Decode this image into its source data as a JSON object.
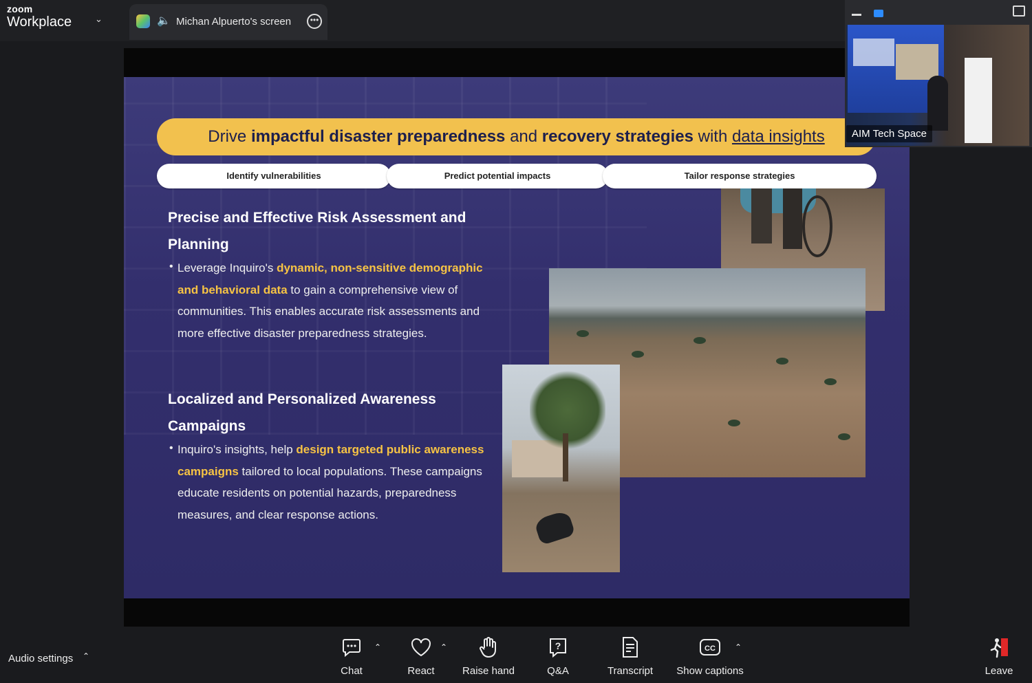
{
  "app": {
    "brand_top": "zoom",
    "brand_name": "Workplace"
  },
  "share_tab": {
    "label": "Michan Alpuerto's screen"
  },
  "thumbnail": {
    "participant_name": "AIM Tech Space"
  },
  "slide": {
    "banner": {
      "part1": "Drive ",
      "bold1": "impactful disaster preparedness",
      "part2": " and ",
      "bold2": "recovery strategies",
      "part3": " with ",
      "underlined": "data insights"
    },
    "pills": [
      "Identify vulnerabilities",
      "Predict potential impacts",
      "Tailor response strategies"
    ],
    "section1": {
      "heading": "Precise and Effective Risk Assessment and Planning",
      "text_before": "Leverage Inquiro's ",
      "highlight": "dynamic, non-sensitive demographic and behavioral data",
      "text_after": " to gain a comprehensive view of communities. This enables accurate risk assessments and more effective disaster preparedness strategies."
    },
    "section2": {
      "heading": "Localized and Personalized Awareness Campaigns",
      "text_before": "Inquiro's insights,  help ",
      "highlight": "design targeted public awareness campaigns",
      "text_after": " tailored to local populations. These campaigns educate residents on potential hazards, preparedness measures, and clear response actions."
    }
  },
  "toolbar": {
    "audio_settings": "Audio settings",
    "buttons": {
      "chat": "Chat",
      "react": "React",
      "raise_hand": "Raise hand",
      "qa": "Q&A",
      "transcript": "Transcript",
      "captions": "Show captions",
      "leave": "Leave"
    }
  },
  "colors": {
    "accent_yellow": "#f2c14e",
    "highlight_text": "#f6c344",
    "slide_bg": "#332f6d",
    "leave_red": "#e02828"
  }
}
